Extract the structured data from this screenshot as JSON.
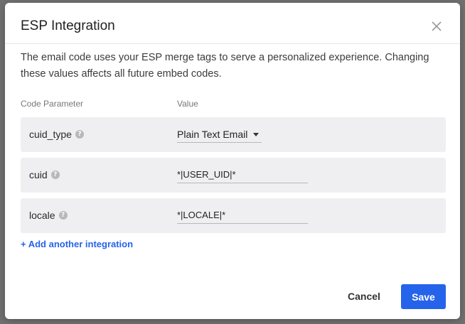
{
  "modal": {
    "title": "ESP Integration",
    "description": "The email code uses your ESP merge tags to serve a personalized experience. Changing these values affects all future embed codes."
  },
  "table": {
    "headers": {
      "parameter": "Code Parameter",
      "value": "Value"
    },
    "rows": [
      {
        "name": "cuid_type",
        "value": "Plain Text Email",
        "control": "select"
      },
      {
        "name": "cuid",
        "value": "*|USER_UID|*",
        "control": "text"
      },
      {
        "name": "locale",
        "value": "*|LOCALE|*",
        "control": "text"
      }
    ]
  },
  "actions": {
    "add_integration": "+ Add another integration",
    "cancel": "Cancel",
    "save": "Save"
  },
  "colors": {
    "accent": "#2563eb",
    "row_background": "#efeff1"
  },
  "icons": {
    "close": "close-icon",
    "help": "help-icon",
    "caret": "caret-down-icon"
  }
}
